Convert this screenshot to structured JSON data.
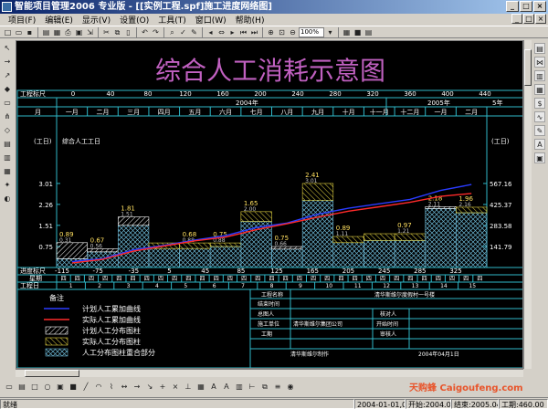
{
  "window": {
    "title": "智能项目管理2006 专业版 - [[实例工程.spf]施工进度网络图]",
    "controls": [
      "_",
      "□",
      "×"
    ]
  },
  "menu": [
    "项目(F)",
    "编辑(E)",
    "显示(V)",
    "设置(O)",
    "工具(T)",
    "窗口(W)",
    "帮助(H)"
  ],
  "toolbar": {
    "zoom": "100%"
  },
  "chart": {
    "title": "综合人工消耗示意图",
    "scale_label": "工程标尺",
    "scale_ticks": [
      "0",
      "40",
      "80",
      "120",
      "160",
      "200",
      "240",
      "280",
      "320",
      "360",
      "400",
      "440"
    ],
    "month_row_label": "月",
    "year_2004": "2004年",
    "year_2005": "2005年",
    "year_right": "5年",
    "months": [
      "一月",
      "二月",
      "三月",
      "四月",
      "五月",
      "六月",
      "七月",
      "八月",
      "九月",
      "十月",
      "十一月",
      "十二月",
      "一月",
      "二月"
    ],
    "left_unit": "(工日)",
    "right_unit": "(工日)",
    "series_title": "综合人工工日",
    "y_ticks_left": [
      "3.01",
      "2.26",
      "1.51",
      "0.75"
    ],
    "y_ticks_right": [
      "567.16",
      "425.37",
      "283.58",
      "141.79"
    ],
    "progress_label": "进度标尺",
    "progress_ticks": [
      "-115",
      "-75",
      "-35",
      "5",
      "45",
      "85",
      "125",
      "165",
      "205",
      "245",
      "285",
      "325"
    ],
    "week_label": "星期",
    "week_marks": [
      "四",
      "四",
      "四",
      "四",
      "四",
      "四",
      "四",
      "四",
      "四",
      "四",
      "四",
      "四",
      "四",
      "四",
      "四",
      "四",
      "四",
      "四",
      "四",
      "四",
      "四",
      "四",
      "四",
      "四",
      "四",
      "四",
      "四",
      "四",
      "四",
      "四",
      "四"
    ],
    "workday_label": "工程日",
    "workdays": [
      "1",
      "2",
      "3",
      "4",
      "5",
      "6",
      "7",
      "8",
      "9",
      "10",
      "11",
      "12",
      "13",
      "14",
      "15"
    ],
    "bar_labels": [
      {
        "top": "0.89",
        "bottom": "0.31"
      },
      {
        "top": "0.67",
        "bottom": "0.56"
      },
      {
        "top": "1.81",
        "bottom": "1.51"
      },
      {
        "top": "0.68",
        "bottom": "0.88"
      },
      {
        "top": "0.75",
        "bottom": "0.88"
      },
      {
        "top": "1.65",
        "bottom": "2.00"
      },
      {
        "top": "0.75",
        "bottom": "0.66"
      },
      {
        "top": "2.41",
        "bottom": "3.01"
      },
      {
        "top": "0.89",
        "bottom": "1.11"
      },
      {
        "top": "0.97",
        "bottom": "1.21"
      },
      {
        "top": "2.18",
        "bottom": "2.11"
      },
      {
        "top": "1.96",
        "bottom": "2.16"
      }
    ],
    "colors": {
      "plan_cum": "#2a3cff",
      "actual_cum": "#ff2a2a",
      "grid": "#2fb8c8",
      "title": "#c060c0",
      "text": "#ffffff"
    }
  },
  "chart_data": {
    "type": "bar",
    "title": "综合人工消耗示意图",
    "categories": [
      "一月",
      "二月",
      "三月",
      "四月",
      "五月",
      "六月",
      "七月",
      "八月",
      "九月",
      "十月",
      "十一月",
      "十二月",
      "一月",
      "二月"
    ],
    "series": [
      {
        "name": "计划人工分布图柱",
        "values": [
          0.89,
          0.67,
          1.81,
          0.68,
          0.68,
          0.75,
          1.65,
          0.75,
          2.41,
          0.89,
          0.97,
          0.97,
          2.18,
          1.96
        ]
      },
      {
        "name": "实际人工分布图柱",
        "values": [
          0.31,
          0.56,
          1.51,
          0.88,
          0.88,
          0.88,
          2.0,
          0.66,
          3.01,
          1.11,
          1.21,
          1.21,
          2.11,
          2.16
        ]
      },
      {
        "name": "计划人工累加曲线",
        "values": [
          40,
          60,
          120,
          150,
          185,
          215,
          270,
          300,
          360,
          400,
          430,
          460,
          520,
          560
        ]
      },
      {
        "name": "实际人工累加曲线",
        "values": [
          30,
          55,
          110,
          145,
          180,
          205,
          255,
          295,
          340,
          380,
          410,
          440,
          480,
          500
        ]
      }
    ],
    "ylim_left": [
      0,
      3.01
    ],
    "ylim_right": [
      0,
      567.16
    ],
    "ylabel_left": "(工日)",
    "ylabel_right": "(工日)"
  },
  "legend": {
    "heading": "备注",
    "items": [
      {
        "label": "计划人工累加曲线",
        "kind": "line-blue"
      },
      {
        "label": "实际人工累加曲线",
        "kind": "line-red"
      },
      {
        "label": "计划人工分布图柱",
        "kind": "hatch-white"
      },
      {
        "label": "实际人工分布图柱",
        "kind": "hatch-yellow"
      },
      {
        "label": "人工分布图柱重合部分",
        "kind": "hatch-cross"
      }
    ]
  },
  "info": {
    "project_label": "工程名称",
    "project_value": "清华斯维尔度假村一号楼",
    "review_time_label": "结束时间",
    "manager_label": "总图人",
    "checker_label": "核对人",
    "org_label": "施工单位",
    "org_value": "清华斯维尔集团公司",
    "start_label": "开始时间",
    "period_label": "工期",
    "approver_label": "审核人",
    "maker": "清华斯维尔制作",
    "date": "2004年04月1日"
  },
  "status": {
    "ready": "就绪",
    "cells": [
      "2004-01-01,0",
      "开始:2004.01.",
      "结束:2005.04.",
      "工期:460.00"
    ]
  },
  "watermark": "天购蜂 Caigoufeng.com"
}
